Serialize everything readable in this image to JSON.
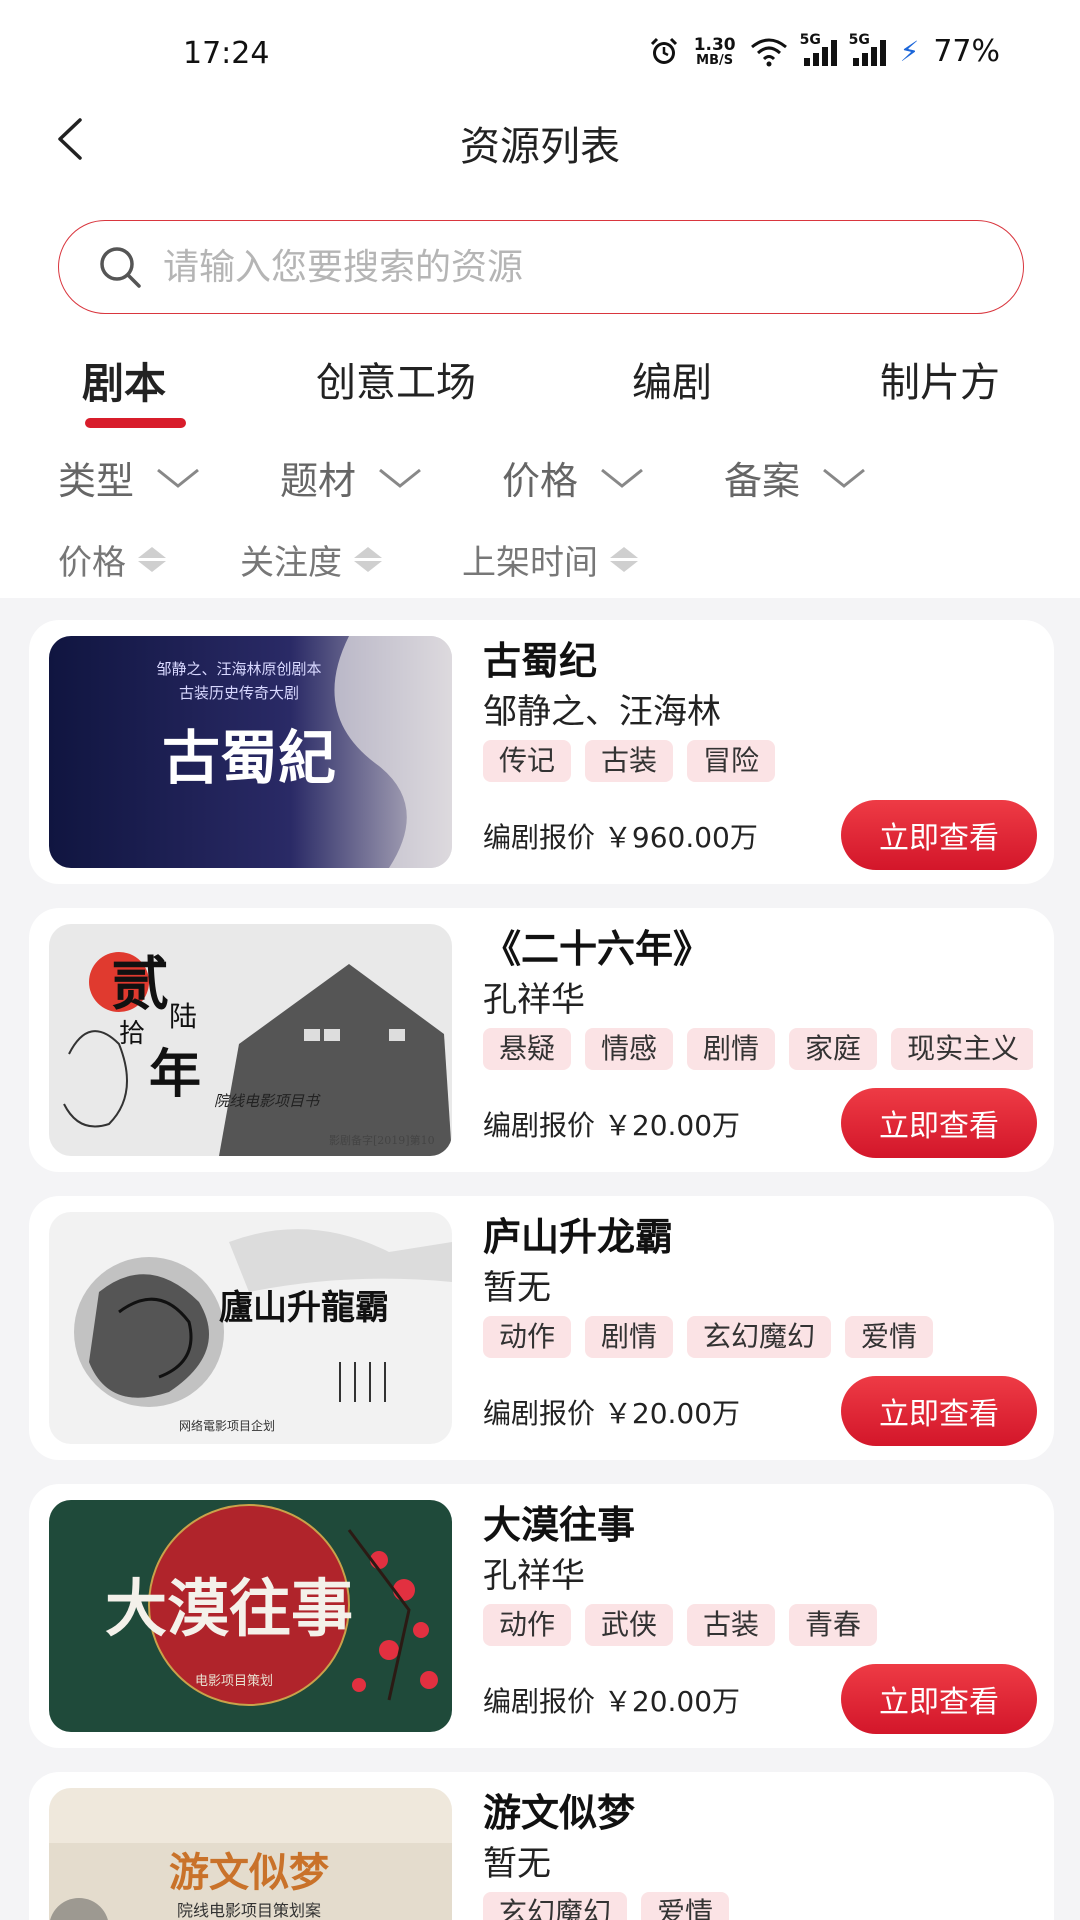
{
  "status_bar": {
    "time": "17:24",
    "speed_value": "1.30",
    "speed_unit": "MB/S",
    "net1": "5G",
    "net2": "5G",
    "battery": "77%"
  },
  "header": {
    "title": "资源列表"
  },
  "search": {
    "placeholder": "请输入您要搜索的资源"
  },
  "tabs": [
    {
      "label": "剧本",
      "active": true
    },
    {
      "label": "创意工场",
      "active": false
    },
    {
      "label": "编剧",
      "active": false
    },
    {
      "label": "制片方",
      "active": false
    }
  ],
  "filters": [
    {
      "label": "类型"
    },
    {
      "label": "题材"
    },
    {
      "label": "价格"
    },
    {
      "label": "备案"
    }
  ],
  "sorts": [
    {
      "label": "价格"
    },
    {
      "label": "关注度"
    },
    {
      "label": "上架时间"
    }
  ],
  "colors": {
    "accent": "#d81d2b",
    "tag_bg": "#fbe3e5",
    "list_bg": "#f4f4f6"
  },
  "cards": [
    {
      "title": "古蜀纪",
      "author": "邹静之、汪海林",
      "tags": [
        "传记",
        "古装",
        "冒险"
      ],
      "price": "编剧报价 ￥960.00万",
      "button": "立即查看",
      "poster": {
        "headline": "古蜀紀",
        "line1": "邹静之、汪海林原创剧本",
        "line2": "古装历史传奇大剧"
      }
    },
    {
      "title": "《二十六年》",
      "author": "孔祥华",
      "tags": [
        "悬疑",
        "情感",
        "剧情",
        "家庭",
        "现实主义"
      ],
      "price": "编剧报价 ￥20.00万",
      "button": "立即查看",
      "poster": {
        "c1": "贰",
        "c2": "拾",
        "c3": "陆",
        "c4": "年",
        "sub": "院线电影项目书",
        "code": "影剧备字[2019]第10"
      }
    },
    {
      "title": "庐山升龙霸",
      "author": "暂无",
      "tags": [
        "动作",
        "剧情",
        "玄幻魔幻",
        "爱情"
      ],
      "price": "编剧报价 ￥20.00万",
      "button": "立即查看",
      "poster": {
        "headline": "廬山升龍霸",
        "sub": "网络電影项目企划"
      }
    },
    {
      "title": "大漠往事",
      "author": "孔祥华",
      "tags": [
        "动作",
        "武侠",
        "古装",
        "青春"
      ],
      "price": "编剧报价 ￥20.00万",
      "button": "立即查看",
      "poster": {
        "headline": "大漠往事",
        "sub": "电影项目策划"
      }
    },
    {
      "title": "游文似梦",
      "author": "暂无",
      "tags": [
        "玄幻魔幻",
        "爱情"
      ],
      "price": "",
      "button": "",
      "poster": {
        "headline": "游文似梦",
        "sub": "院线电影项目策划案"
      }
    }
  ]
}
